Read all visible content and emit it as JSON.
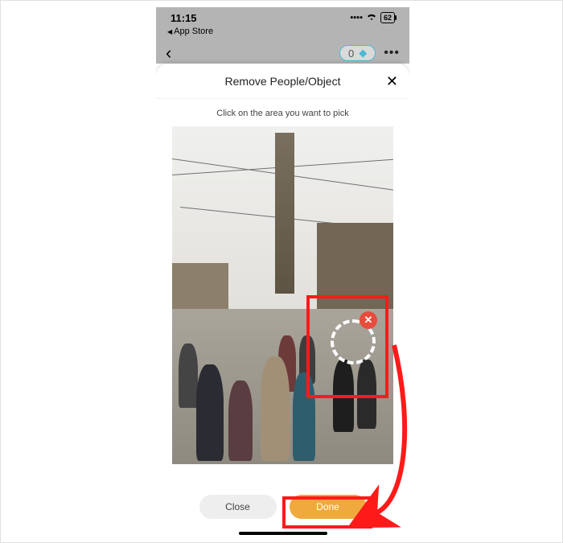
{
  "status": {
    "time": "11:15",
    "battery": "62"
  },
  "appstore_back": "App Store",
  "gem": {
    "count": "0"
  },
  "sheet": {
    "title": "Remove People/Object",
    "instruction": "Click on the area you want to pick"
  },
  "buttons": {
    "close": "Close",
    "done": "Done"
  },
  "annotation": {
    "box_color": "#ff1a1a",
    "arrow_color": "#ff1a1a"
  }
}
